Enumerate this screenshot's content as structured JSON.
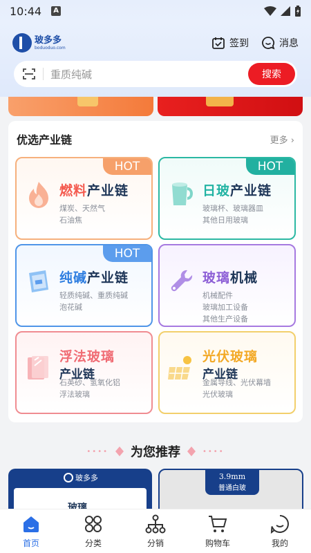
{
  "status_bar": {
    "time": "10:44",
    "a_label": "A"
  },
  "header": {
    "logo_cn": "玻多多",
    "logo_en": "boduoduo.com",
    "checkin_label": "签到",
    "message_label": "消息"
  },
  "search": {
    "placeholder": "重质纯碱",
    "button_label": "搜索"
  },
  "chain": {
    "title": "优选产业链",
    "more_label": "更多 ›",
    "tiles": [
      {
        "hot": "HOT",
        "title_hl": "燃料",
        "title_suffix": "产业链",
        "lines": [
          "煤炭、天然气",
          "石油焦"
        ]
      },
      {
        "hot": "HOT",
        "title_hl": "日玻",
        "title_suffix": "产业链",
        "lines": [
          "玻璃杯、玻璃器皿",
          "其他日用玻璃"
        ]
      },
      {
        "hot": "HOT",
        "title_hl": "纯碱",
        "title_suffix": "产业链",
        "lines": [
          "轻质纯碱、重质纯碱",
          "泡花碱"
        ]
      },
      {
        "title_hl": "玻璃",
        "title_suffix": "机械",
        "lines": [
          "机械配件",
          "玻璃加工设备",
          "其他生产设备"
        ]
      },
      {
        "title_hl": "浮法玻璃",
        "sub": "产业链",
        "lines": [
          "石英砂、氢氧化铝",
          "浮法玻璃"
        ]
      },
      {
        "title_hl": "光伏玻璃",
        "sub": "产业链",
        "lines": [
          "金属导线、光伏幕墙",
          "光伏玻璃"
        ]
      }
    ]
  },
  "recommend": {
    "title": "为您推荐",
    "products": [
      {
        "logo": "玻多多",
        "name": "玻璃"
      },
      {
        "tag_a": "3.9mm",
        "tag_b": "普通白玻"
      }
    ]
  },
  "nav": {
    "items": [
      {
        "label": "首页",
        "active": true
      },
      {
        "label": "分类"
      },
      {
        "label": "分销"
      },
      {
        "label": "购物车"
      },
      {
        "label": "我的"
      }
    ]
  },
  "colors": {
    "accent": "#2b6fe6",
    "search_button": "#ec1c24",
    "brand": "#1f4fa8"
  }
}
